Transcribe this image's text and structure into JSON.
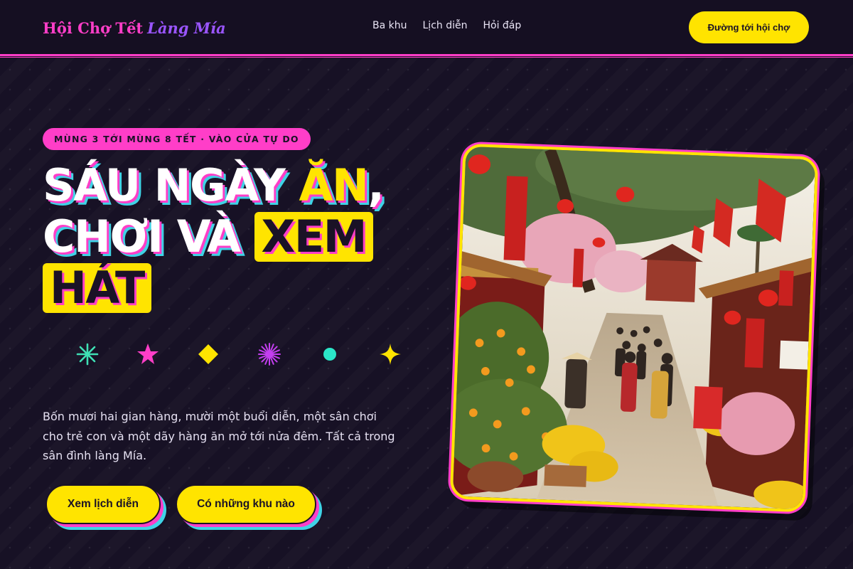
{
  "header": {
    "brand_main": "Hội Chợ Tết",
    "brand_accent": "Làng Mía",
    "nav": [
      "Ba khu",
      "Lịch diễn",
      "Hỏi đáp"
    ],
    "cta": "Đường tới hội chợ"
  },
  "hero": {
    "eyebrow": "MÙNG 3 TỚI MÙNG 8 TẾT · VÀO CỬA TỰ DO",
    "headline": {
      "part1": "SÁU NGÀY ",
      "highlight": "ĂN",
      "part2": ", CHƠI VÀ ",
      "box_word": "XEM HÁT"
    },
    "description": "Bốn mươi hai gian hàng, mười một buổi diễn, một sân chơi cho trẻ con và một dãy hàng ăn mở tới nửa đêm. Tất cả trong sân đình làng Mía.",
    "buttons": {
      "schedule": "Xem lịch diễn",
      "zones": "Có những khu nào"
    },
    "decorations": [
      "asterisk-icon",
      "star-icon",
      "diamond-icon",
      "firework-icon",
      "dot-icon",
      "sparkle-icon"
    ]
  },
  "colors": {
    "background": "#171125",
    "magenta": "#ff3ec8",
    "yellow": "#ffe400",
    "cyan": "#3fd3e6",
    "violet": "#9a55ff"
  }
}
